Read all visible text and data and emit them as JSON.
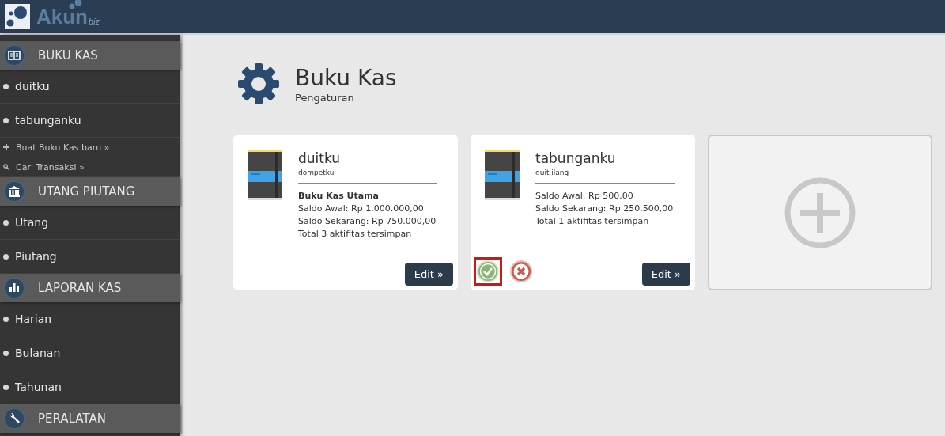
{
  "logo": {
    "name": "Akun",
    "suffix": "biz"
  },
  "sidebar": {
    "sections": [
      {
        "title": "BUKU KAS",
        "kind": "book",
        "items": [
          {
            "label": "duitku",
            "kind": "entry"
          },
          {
            "label": "tabunganku",
            "kind": "entry"
          },
          {
            "label": "Buat Buku Kas baru »",
            "kind": "add"
          },
          {
            "label": "Cari Transaksi »",
            "kind": "search"
          }
        ]
      },
      {
        "title": "UTANG PIUTANG",
        "kind": "bank",
        "items": [
          {
            "label": "Utang",
            "kind": "entry"
          },
          {
            "label": "Piutang",
            "kind": "entry"
          }
        ]
      },
      {
        "title": "LAPORAN KAS",
        "kind": "chart",
        "items": [
          {
            "label": "Harian",
            "kind": "entry"
          },
          {
            "label": "Bulanan",
            "kind": "entry"
          },
          {
            "label": "Tahunan",
            "kind": "entry"
          }
        ]
      },
      {
        "title": "PERALATAN",
        "kind": "wrench"
      }
    ]
  },
  "page": {
    "title": "Buku Kas",
    "subtitle": "Pengaturan"
  },
  "cards": [
    {
      "kind": "book",
      "name": "duitku",
      "note": "dompetku",
      "primary_label": "Buku Kas Utama",
      "lines": [
        "Saldo Awal: Rp 1.000.000,00",
        "Saldo Sekarang: Rp 750.000,00",
        "Total 3 aktifitas tersimpan"
      ],
      "button": "Edit »"
    },
    {
      "kind": "book",
      "name": "tabunganku",
      "note": "duit ilang",
      "lines": [
        "Saldo Awal: Rp 500,00",
        "Saldo Sekarang: Rp 250.500,00",
        "Total 1 aktifitas tersimpan"
      ],
      "actions": [
        {
          "kind": "set-primary",
          "highlighted": true
        },
        {
          "kind": "delete",
          "highlighted": false
        }
      ],
      "button": "Edit »"
    },
    {
      "kind": "add"
    }
  ]
}
